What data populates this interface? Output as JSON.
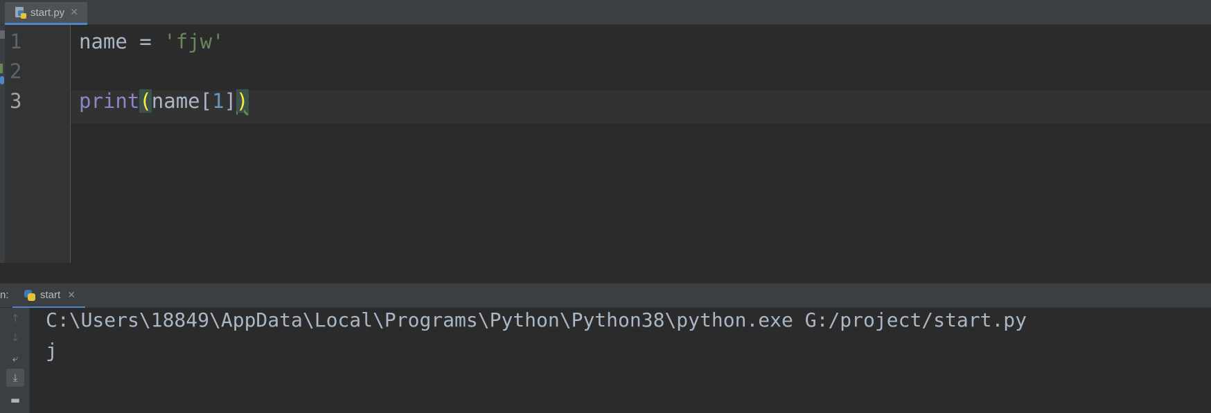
{
  "editor_tab": {
    "file_name": "start.py",
    "close_glyph": "✕",
    "icon": "python-file-icon"
  },
  "editor": {
    "line_numbers": [
      "1",
      "2",
      "3"
    ],
    "current_line": "3",
    "lines": {
      "l1": {
        "var": "name",
        "op": " = ",
        "str": "'fjw'"
      },
      "l3": {
        "builtin": "print",
        "open": "(",
        "arg": "name",
        "lbr": "[",
        "num": "1",
        "rbr": "]",
        "close": ")"
      }
    }
  },
  "run_panel": {
    "prefix": "n:",
    "tab_label": "start",
    "close_glyph": "✕",
    "toolbar": {
      "up": "↑",
      "down": "↓",
      "wrap": "⤶",
      "scroll_end": "⤓",
      "print": "▬"
    },
    "console": [
      "C:\\Users\\18849\\AppData\\Local\\Programs\\Python\\Python38\\python.exe G:/project/start.py",
      "j"
    ]
  },
  "colors": {
    "background": "#2b2b2b",
    "panel": "#3c3f41",
    "keyword_builtin": "#8888c6",
    "string": "#6a8759",
    "number": "#6897bb",
    "brace_highlight": "#ffef28",
    "text": "#a9b7c6"
  }
}
